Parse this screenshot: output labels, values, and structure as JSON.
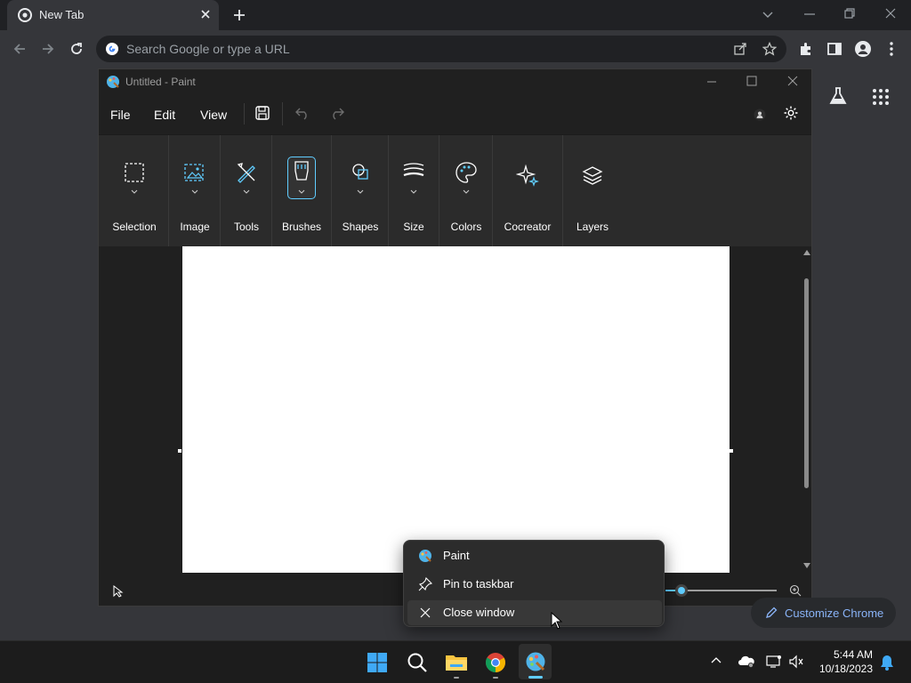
{
  "browser": {
    "tab_title": "New Tab",
    "omnibox_placeholder": "Search Google or type a URL",
    "customize_label": "Customize Chrome"
  },
  "paint": {
    "window_title": "Untitled - Paint",
    "menus": [
      "File",
      "Edit",
      "View"
    ],
    "groups": [
      {
        "label": "Selection",
        "icon": "selection-icon"
      },
      {
        "label": "Image",
        "icon": "image-icon"
      },
      {
        "label": "Tools",
        "icon": "tools-icon"
      },
      {
        "label": "Brushes",
        "icon": "brush-icon"
      },
      {
        "label": "Shapes",
        "icon": "shapes-icon"
      },
      {
        "label": "Size",
        "icon": "size-icon"
      },
      {
        "label": "Colors",
        "icon": "palette-icon"
      },
      {
        "label": "Cocreator",
        "icon": "sparkle-icon"
      },
      {
        "label": "Layers",
        "icon": "layers-icon"
      }
    ]
  },
  "context_menu": {
    "items": [
      {
        "label": "Paint",
        "icon": "paint-app-icon"
      },
      {
        "label": "Pin to taskbar",
        "icon": "pin-icon"
      },
      {
        "label": "Close window",
        "icon": "close-icon"
      }
    ]
  },
  "taskbar": {
    "time": "5:44 AM",
    "date": "10/18/2023"
  },
  "colors": {
    "accent": "#60cdff",
    "chrome_bg": "#35363a",
    "paint_bg": "#202020"
  }
}
